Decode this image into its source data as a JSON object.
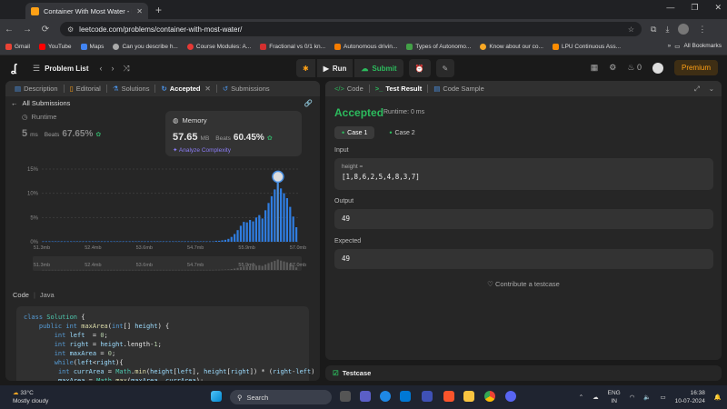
{
  "browser": {
    "tab_title": "Container With Most Water - Le",
    "url": "leetcode.com/problems/container-with-most-water/",
    "bookmarks": [
      "Gmail",
      "YouTube",
      "Maps",
      "Can you describe h...",
      "Course Modules: A...",
      "Fractional vs 0/1 kn...",
      "Autonomous drivin...",
      "Types of Autonomo...",
      "Know about our co...",
      "LPU Continuous Ass..."
    ],
    "all_bookmarks": "All Bookmarks"
  },
  "nav": {
    "problem_list": "Problem List",
    "run": "Run",
    "submit": "Submit",
    "streak": "0",
    "premium": "Premium"
  },
  "left": {
    "tabs": [
      "Description",
      "Editorial",
      "Solutions",
      "Accepted",
      "Submissions"
    ],
    "all_submissions": "All Submissions",
    "runtime": {
      "label": "Runtime",
      "value": "5",
      "unit": "ms",
      "beats": "Beats",
      "pct": "67.65%"
    },
    "memory": {
      "label": "Memory",
      "value": "57.65",
      "unit": "MB",
      "beats": "Beats",
      "pct": "60.45%"
    },
    "analyze": "Analyze Complexity",
    "code_label": "Code",
    "lang": "Java"
  },
  "chart_data": {
    "type": "bar",
    "y_ticks": [
      "15%",
      "10%",
      "5%",
      "0%"
    ],
    "ylim": [
      0,
      15
    ],
    "x_ticks": [
      "51.3mb",
      "52.4mb",
      "53.6mb",
      "54.7mb",
      "55.9mb",
      "57.0mb"
    ],
    "values": [
      0.1,
      0.1,
      0.1,
      0.1,
      0.1,
      0.1,
      0.1,
      0.1,
      0.1,
      0.1,
      0.1,
      0.1,
      0.1,
      0.1,
      0.1,
      0.1,
      0.1,
      0.1,
      0.1,
      0.1,
      0.1,
      0.1,
      0.1,
      0.1,
      0.1,
      0.1,
      0.1,
      0.1,
      0.1,
      0.1,
      0.1,
      0.1,
      0.1,
      0.1,
      0.1,
      0.1,
      0.1,
      0.1,
      0.1,
      0.1,
      0.1,
      0.1,
      0.1,
      0.1,
      0.1,
      0.1,
      0.1,
      0.1,
      0.1,
      0.1,
      0.1,
      0.1,
      0.1,
      0.1,
      0.1,
      0.1,
      0.2,
      0.2,
      0.3,
      0.4,
      0.6,
      1.0,
      1.6,
      2.4,
      3.3,
      4.1,
      4.0,
      4.5,
      4.2,
      5.0,
      5.5,
      4.8,
      6.5,
      8.0,
      9.4,
      10.8,
      12.3,
      11.0,
      10.0,
      9.0,
      7.2,
      5.2,
      3.0
    ],
    "highlight_index": 76
  },
  "right": {
    "tabs": [
      "Code",
      "Test Result",
      "Code Sample"
    ],
    "status": "Accepted",
    "runtime": "Runtime: 0 ms",
    "cases": [
      "Case 1",
      "Case 2"
    ],
    "input_label": "Input",
    "input_name": "height =",
    "input_value": "[1,8,6,2,5,4,8,3,7]",
    "output_label": "Output",
    "output_value": "49",
    "expected_label": "Expected",
    "expected_value": "49",
    "contribute": "Contribute a testcase",
    "testcase": "Testcase"
  },
  "taskbar": {
    "temp": "33°C",
    "weather": "Mostly cloudy",
    "search": "Search",
    "lang1": "ENG",
    "lang2": "IN",
    "time": "16:38",
    "date": "10-07-2024"
  }
}
